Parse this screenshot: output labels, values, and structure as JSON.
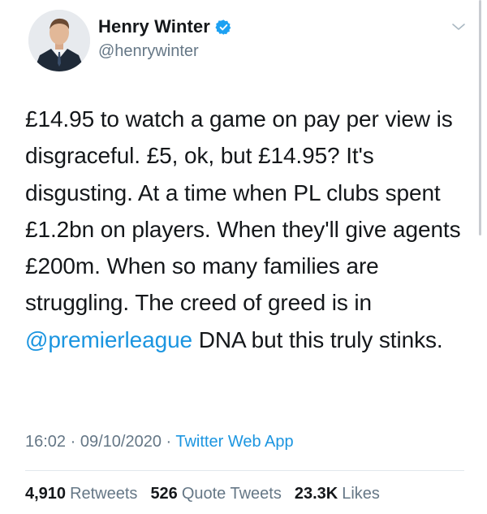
{
  "author": {
    "display_name": "Henry Winter",
    "handle": "@henrywinter",
    "verified": true,
    "avatar_icon": "avatar-icon"
  },
  "tweet": {
    "segments": [
      {
        "text": "£14.95 to watch a game on pay per view is disgraceful. £5, ok, but £14.95? It's disgusting. At a time when PL clubs spent £1.2bn on players. When they'll give agents £200m. When so many families are struggling. The creed of greed is in "
      },
      {
        "mention": "@premierleague"
      },
      {
        "text": " DNA but this truly stinks."
      }
    ]
  },
  "meta": {
    "time": "16:02",
    "date": "09/10/2020",
    "separator": " · ",
    "source": "Twitter Web App"
  },
  "stats": {
    "retweets_count": "4,910",
    "retweets_label": "Retweets",
    "quotes_count": "526",
    "quotes_label": "Quote Tweets",
    "likes_count": "23.3K",
    "likes_label": "Likes"
  },
  "colors": {
    "link": "#1b95e0",
    "secondary": "#657786",
    "verified_badge": "#1da1f2"
  }
}
